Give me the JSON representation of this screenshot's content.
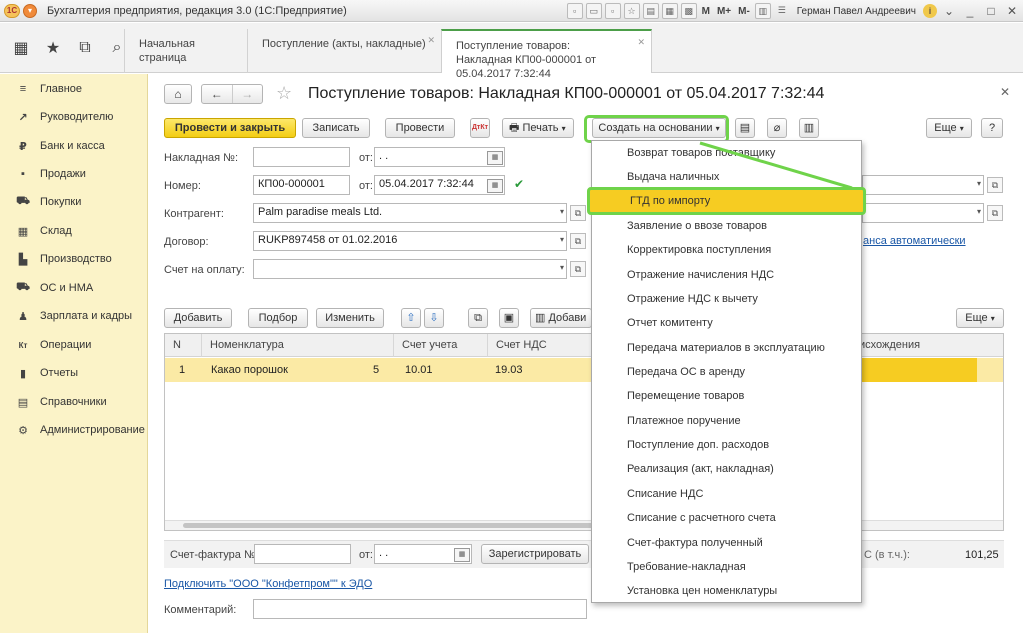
{
  "window": {
    "title": "Бухгалтерия предприятия, редакция 3.0  (1С:Предприятие)",
    "user": "Герман Павел Андреевич",
    "m_labels": [
      "M",
      "M+",
      "M-"
    ]
  },
  "tabs": [
    {
      "label": "Начальная страница"
    },
    {
      "label": "Поступление (акты, накладные)"
    },
    {
      "label": "Поступление товаров: Накладная КП00-000001 от 05.04.2017 7:32:44"
    }
  ],
  "sidebar": {
    "items": [
      {
        "label": "Главное",
        "icon": "≡"
      },
      {
        "label": "Руководителю",
        "icon": "↗"
      },
      {
        "label": "Банк и касса",
        "icon": "₽"
      },
      {
        "label": "Продажи",
        "icon": "▪"
      },
      {
        "label": "Покупки",
        "icon": "⛟"
      },
      {
        "label": "Склад",
        "icon": "▦"
      },
      {
        "label": "Производство",
        "icon": "▙"
      },
      {
        "label": "ОС и НМА",
        "icon": "⛟"
      },
      {
        "label": "Зарплата и кадры",
        "icon": "♟"
      },
      {
        "label": "Операции",
        "icon": "Кт"
      },
      {
        "label": "Отчеты",
        "icon": "▮"
      },
      {
        "label": "Справочники",
        "icon": "▤"
      },
      {
        "label": "Администрирование",
        "icon": "⚙"
      }
    ]
  },
  "document": {
    "title": "Поступление товаров: Накладная КП00-000001 от 05.04.2017 7:32:44"
  },
  "toolbar": {
    "post_close": "Провести и закрыть",
    "save": "Записать",
    "post": "Провести",
    "print": "Печать",
    "create_based": "Создать на основании",
    "more": "Еще",
    "help": "?"
  },
  "form": {
    "invoice_label": "Накладная №:",
    "invoice_value": "",
    "from_label": "от:",
    "invoice_date": " .  .",
    "number_label": "Номер:",
    "number_value": "КП00-000001",
    "date_value": "05.04.2017  7:32:44",
    "counterparty_label": "Контрагент:",
    "counterparty_value": "Palm paradise meals Ltd.",
    "contract_label": "Договор:",
    "contract_value": "RUKP897458 от 01.02.2016",
    "payment_label": "Счет на оплату:",
    "payment_value": "",
    "auto_link": "анса автоматически"
  },
  "table_toolbar": {
    "add": "Добавить",
    "select": "Подбор",
    "change": "Изменить",
    "add2": "Добави",
    "more": "Еще"
  },
  "table": {
    "columns": [
      "N",
      "Номенклатура",
      "Счет учета",
      "Счет НДС",
      "исхождения"
    ],
    "rows": [
      {
        "n": "1",
        "name": "Какао порошок",
        "mark": "5",
        "account": "10.01",
        "vat_account": "19.03"
      }
    ]
  },
  "footer": {
    "invoice_label": "Счет-фактура №:",
    "invoice_value": "",
    "from_label": "от:",
    "date_value": " .  .",
    "register": "Зарегистрировать",
    "vat_label": "С (в т.ч.):",
    "vat_value": "101,25",
    "edo_link": "Подключить \"ООО \"Конфетпром\"\" к ЭДО",
    "comment_label": "Комментарий:",
    "comment_value": ""
  },
  "dropdown": {
    "items": [
      "Возврат товаров поставщику",
      "Выдача наличных",
      "ГТД по импорту",
      "Заявление о ввозе товаров",
      "Корректировка поступления",
      "Отражение начисления НДС",
      "Отражение НДС к вычету",
      "Отчет комитенту",
      "Передача материалов в эксплуатацию",
      "Передача ОС в аренду",
      "Перемещение товаров",
      "Платежное поручение",
      "Поступление доп. расходов",
      "Реализация (акт, накладная)",
      "Списание НДС",
      "Списание с расчетного счета",
      "Счет-фактура полученный",
      "Требование-накладная",
      "Установка цен номенклатуры"
    ],
    "highlighted": "ГТД по импорту"
  },
  "colors": {
    "accent_yellow": "#f3cd14",
    "sidebar_bg": "#fbf3c8",
    "highlight_green": "#6fd34a",
    "link_blue": "#1a57a6"
  }
}
